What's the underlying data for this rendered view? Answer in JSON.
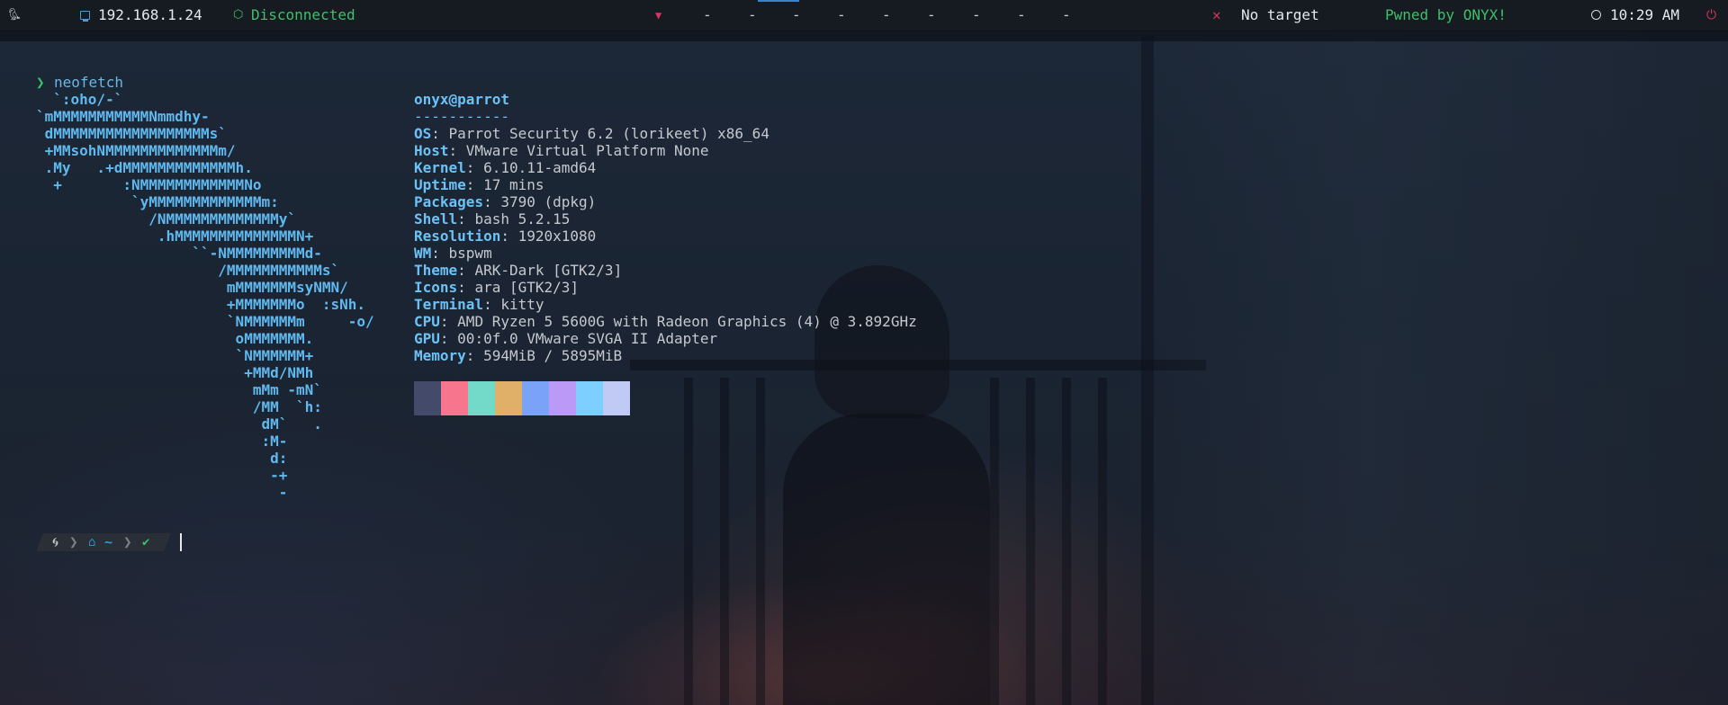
{
  "topbar": {
    "parrot_icon": "parrot-logo-icon",
    "ip_address": "192.168.1.24",
    "vpn_status": "Disconnected",
    "workspaces": [
      "-",
      "-",
      "-",
      "-",
      "-",
      "-",
      "-",
      "-",
      "-"
    ],
    "active_workspace_index": 2,
    "target": "No target",
    "pwned_label": "Pwned by ONYX!",
    "time": "10:29 AM",
    "colors": {
      "bar_bg": "#161b22",
      "ok": "#3fbf6a",
      "alert": "#e0325f",
      "accent": "#3b83c9"
    }
  },
  "terminal": {
    "prompt_symbol": "❯",
    "command": "neofetch",
    "ascii_art": "  `:oho/-`\n`mMMMMMMMMMMMNmmdhy-\n dMMMMMMMMMMMMMMMMMMs`\n +MMsohNMMMMMMMMMMMMMm/\n .My   .+dMMMMMMMMMMMMMh.\n  +       :NMMMMMMMMMMMMNo\n           `yMMMMMMMMMMMMMm:\n             /NMMMMMMMMMMMMMy`\n              .hMMMMMMMMMMMMMMN+\n                  ``-NMMMMMMMMMd-\n                     /MMMMMMMMMMMs`\n                      mMMMMMMMsyNMN/\n                      +MMMMMMMo  :sNh.\n                      `NMMMMMMm     -o/\n                       oMMMMMMM.\n                       `NMMMMMM+\n                        +MMd/NMh\n                         mMm -mN`\n                         /MM  `h:\n                          dM`   .\n                          :M-\n                           d:\n                           -+\n                            -",
    "user_host": "onyx@parrot",
    "separator": "-----------",
    "info": [
      {
        "key": "OS",
        "value": "Parrot Security 6.2 (lorikeet) x86_64"
      },
      {
        "key": "Host",
        "value": "VMware Virtual Platform None"
      },
      {
        "key": "Kernel",
        "value": "6.10.11-amd64"
      },
      {
        "key": "Uptime",
        "value": "17 mins"
      },
      {
        "key": "Packages",
        "value": "3790 (dpkg)"
      },
      {
        "key": "Shell",
        "value": "bash 5.2.15"
      },
      {
        "key": "Resolution",
        "value": "1920x1080"
      },
      {
        "key": "WM",
        "value": "bspwm"
      },
      {
        "key": "Theme",
        "value": "ARK-Dark [GTK2/3]"
      },
      {
        "key": "Icons",
        "value": "ara [GTK2/3]"
      },
      {
        "key": "Terminal",
        "value": "kitty"
      },
      {
        "key": "CPU",
        "value": "AMD Ryzen 5 5600G with Radeon Graphics (4) @ 3.892GHz"
      },
      {
        "key": "GPU",
        "value": "00:0f.0 VMware SVGA II Adapter"
      },
      {
        "key": "Memory",
        "value": "594MiB / 5895MiB"
      }
    ],
    "palette": [
      "#444b6a",
      "#f7768e",
      "#73daca",
      "#e0af68",
      "#7aa2f7",
      "#bb9af7",
      "#7dcfff",
      "#c0caf5"
    ],
    "prompt2": {
      "os_icon": "debian-swirl-icon",
      "home_icon": "home-icon",
      "dir": "~",
      "status_icon": "check-icon"
    }
  }
}
